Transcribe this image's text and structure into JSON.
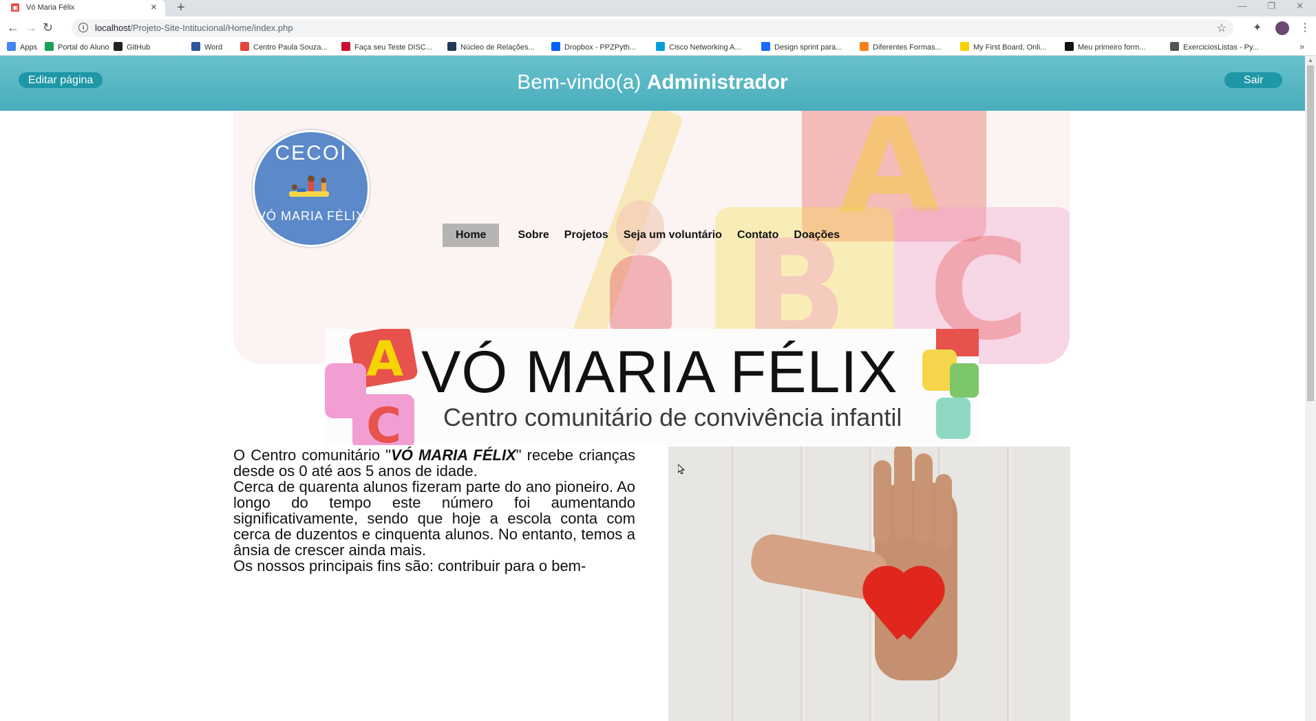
{
  "browser": {
    "tab_title": "Vó Maria Félix",
    "url_host": "localhost",
    "url_path": "/Projeto-Site-Intitucional/Home/index.php",
    "bookmarks": [
      {
        "label": "Apps",
        "color": "#4285f4"
      },
      {
        "label": "Portal do Aluno",
        "color": "#1aa05a"
      },
      {
        "label": "GitHub",
        "color": "#222222"
      },
      {
        "label": "Word",
        "color": "#2b579a"
      },
      {
        "label": "Centro Paula Souza...",
        "color": "#e2463a"
      },
      {
        "label": "Faça seu Teste DISC...",
        "color": "#c8102e"
      },
      {
        "label": "Núcleo de Relações...",
        "color": "#1f3a5a"
      },
      {
        "label": "Dropbox - PPZPyth...",
        "color": "#0061fe"
      },
      {
        "label": "Cisco Networking A...",
        "color": "#049fd9"
      },
      {
        "label": "Design sprint para...",
        "color": "#1769ff"
      },
      {
        "label": "Diferentes Formas...",
        "color": "#f4801f"
      },
      {
        "label": "My First Board, Onli...",
        "color": "#f5d000"
      },
      {
        "label": "Meu primeiro form...",
        "color": "#111111"
      },
      {
        "label": "ExerciciosListas - Py...",
        "color": "#555555"
      }
    ]
  },
  "admin": {
    "edit_label": "Editar página",
    "welcome": "Bem-vindo(a)",
    "user": "Administrador",
    "logout_label": "Sair"
  },
  "logo": {
    "top": "CECOI",
    "bottom": "VÓ MARIA FÉLIX"
  },
  "nav": {
    "items": [
      "Home",
      "Sobre",
      "Projetos",
      "Seja um voluntário",
      "Contato",
      "Doações"
    ]
  },
  "banner": {
    "title": "VÓ MARIA FÉLIX",
    "subtitle": "Centro comunitário de convivência infantil"
  },
  "content": {
    "p1_start": "O Centro comunitário \"",
    "p1_name": "VÓ MARIA FÉLIX",
    "p1_end": "\" recebe crianças desde os 0 até aos 5 anos de idade.",
    "p2": "Cerca de quarenta alunos fizeram parte do ano pioneiro. Ao longo do tempo este número foi aumentando significativamente, sendo que hoje a escola conta com cerca de duzentos e cinquenta alunos. No entanto, temos a ânsia de crescer ainda mais.",
    "p3": "Os nossos principais fins são: contribuir para o bem-"
  },
  "colors": {
    "admin_bar": "#55b5c3",
    "admin_button": "#1e97a6",
    "nav_active": "#b6b3b3"
  }
}
